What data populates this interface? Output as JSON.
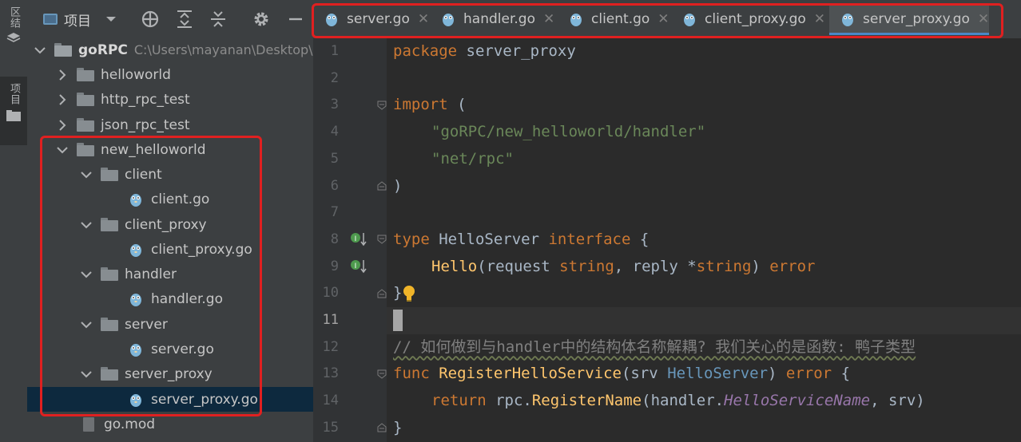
{
  "sidebar_strip": {
    "top_label": "区结",
    "project_label": "项目"
  },
  "project_panel": {
    "title": "项目",
    "root": {
      "name": "goRPC",
      "path": "C:\\Users\\mayanan\\Desktop\\"
    },
    "items": [
      {
        "label": "helloworld"
      },
      {
        "label": "http_rpc_test"
      },
      {
        "label": "json_rpc_test"
      },
      {
        "label": "new_helloworld"
      },
      {
        "label": "client"
      },
      {
        "label": "client.go"
      },
      {
        "label": "client_proxy"
      },
      {
        "label": "client_proxy.go"
      },
      {
        "label": "handler"
      },
      {
        "label": "handler.go"
      },
      {
        "label": "server"
      },
      {
        "label": "server.go"
      },
      {
        "label": "server_proxy"
      },
      {
        "label": "server_proxy.go"
      },
      {
        "label": "go.mod"
      }
    ]
  },
  "tabs": [
    {
      "label": "server.go"
    },
    {
      "label": "handler.go"
    },
    {
      "label": "client.go"
    },
    {
      "label": "client_proxy.go"
    },
    {
      "label": "server_proxy.go",
      "active": true
    }
  ],
  "line_numbers": [
    "1",
    "2",
    "3",
    "4",
    "5",
    "6",
    "7",
    "8",
    "9",
    "10",
    "11",
    "12",
    "13",
    "14",
    "15"
  ],
  "code": {
    "l1_kw": "package",
    "l1_name": " server_proxy",
    "l3_kw": "import",
    "l3_rest": " (",
    "l4_str": "\"goRPC/new_helloworld/handler\"",
    "l5_str": "\"net/rpc\"",
    "l6": ")",
    "l8_kw": "type",
    "l8_name": " HelloServer ",
    "l8_kw2": "interface",
    "l8_rest": " {",
    "l9_fn": "Hello",
    "l9_a": "(request ",
    "l9_t1": "string",
    "l9_b": ", reply *",
    "l9_t2": "string",
    "l9_c": ") ",
    "l9_kw": "error",
    "l10": "}",
    "l12_comment": "// 如何做到与handler中的结构体名称解耦? 我们关心的是函数: 鸭子类型",
    "l13_kw": "func",
    "l13_fn": " RegisterHelloService",
    "l13_a": "(srv ",
    "l13_t": "HelloServer",
    "l13_b": ") ",
    "l13_kw2": "error",
    "l13_c": " {",
    "l14_kw": "return",
    "l14_a": " rpc.",
    "l14_fn": "RegisterName",
    "l14_b": "(handler.",
    "l14_it": "HelloServiceName",
    "l14_c": ", srv)",
    "l15": "}"
  },
  "colors": {
    "highlight_frame": "#e02020",
    "keyword": "#cc7832",
    "string": "#6a8759",
    "function": "#ffc66d"
  }
}
